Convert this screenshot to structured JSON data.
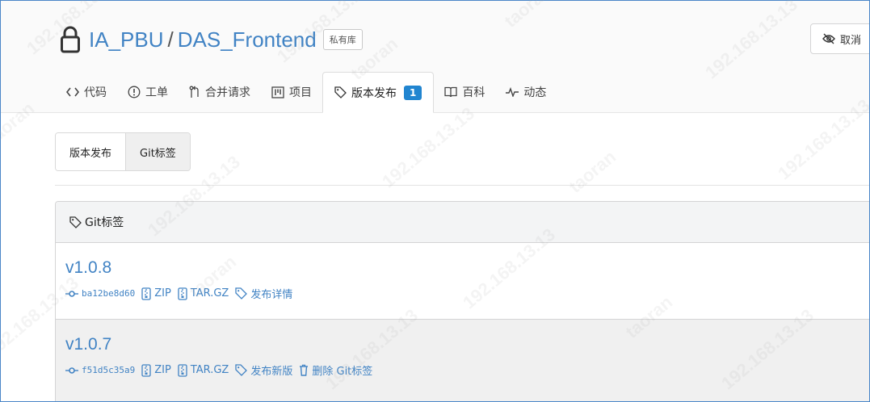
{
  "header": {
    "owner": "IA_PBU",
    "separator": "/",
    "repo": "DAS_Frontend",
    "private_badge": "私有库",
    "unwatch_label": "取消"
  },
  "tabs": [
    {
      "label": "代码",
      "icon": "code-icon"
    },
    {
      "label": "工单",
      "icon": "issue-icon"
    },
    {
      "label": "合并请求",
      "icon": "pull-request-icon"
    },
    {
      "label": "项目",
      "icon": "project-icon"
    },
    {
      "label": "版本发布",
      "icon": "tag-icon",
      "count": "1",
      "active": true
    },
    {
      "label": "百科",
      "icon": "book-icon"
    },
    {
      "label": "动态",
      "icon": "pulse-icon"
    }
  ],
  "subtabs": [
    {
      "label": "版本发布",
      "active": false
    },
    {
      "label": "Git标签",
      "active": true
    }
  ],
  "tag_box": {
    "title": "Git标签",
    "items": [
      {
        "name": "v1.0.8",
        "sha": "ba12be8d60",
        "zip": "ZIP",
        "tar": "TAR.GZ",
        "release_link": "发布详情"
      },
      {
        "name": "v1.0.7",
        "sha": "f51d5c35a9",
        "zip": "ZIP",
        "tar": "TAR.GZ",
        "release_link": "发布新版",
        "delete_link": "删除 Git标签"
      }
    ]
  },
  "watermark": {
    "user": "taoran",
    "ip": "192.168.13.13"
  },
  "colors": {
    "link": "#4183c4",
    "badge": "#2185d0",
    "frame": "#4a86c8"
  }
}
